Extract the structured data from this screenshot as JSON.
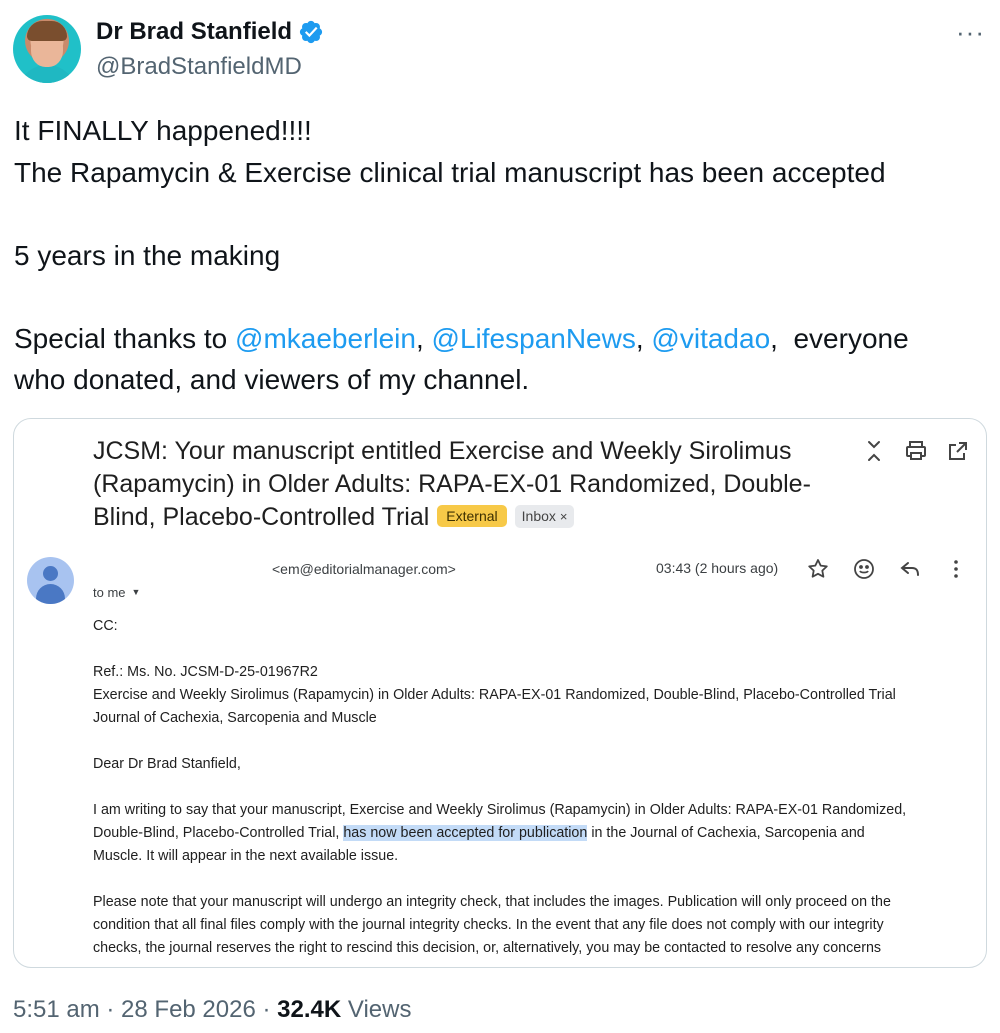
{
  "author": {
    "display_name": "Dr Brad Stanfield",
    "handle": "@BradStanfieldMD",
    "verified": true,
    "verified_color": "#1d9bf0"
  },
  "more_label": "···",
  "tweet": {
    "line1": "It FINALLY happened!!!!",
    "line2": "The Rapamycin & Exercise clinical trial manuscript has been accepted",
    "line3": "5 years in the making",
    "line4_prefix": "Special thanks to ",
    "mention1": "@mkaeberlein",
    "sep1": ", ",
    "mention2": "@LifespanNews",
    "sep2": ", ",
    "mention3": "@vitadao",
    "line4_suffix": ",  everyone",
    "line5": "who donated, and viewers of my channel.",
    "mention_color": "#1d9bf0"
  },
  "email": {
    "subject": "JCSM: Your manuscript entitled Exercise and Weekly Sirolimus (Rapamycin) in Older Adults: RAPA-EX-01 Randomized, Double-Blind, Placebo-Controlled Trial",
    "tag_external": "External",
    "tag_inbox": "Inbox",
    "tag_close": "×",
    "sender": "<em@editorialmanager.com>",
    "time": "03:43 (2 hours ago)",
    "to": "to me",
    "caret": "▼",
    "cc": "CC:",
    "ref": "Ref.:  Ms. No. JCSM-D-25-01967R2",
    "ref_title": "Exercise and Weekly Sirolimus (Rapamycin) in Older Adults: RAPA-EX-01 Randomized, Double-Blind, Placebo-Controlled Trial",
    "journal": "Journal of Cachexia, Sarcopenia and Muscle",
    "greeting": "Dear Dr Brad Stanfield,",
    "p1_a": "I am writing to say that your manuscript, Exercise and Weekly Sirolimus (Rapamycin) in Older Adults: RAPA-EX-01 Randomized,",
    "p1_b": "Double-Blind, Placebo-Controlled Trial, ",
    "p1_highlight": "has now been accepted for publication",
    "p1_c": " in the Journal of Cachexia, Sarcopenia and",
    "p1_d": "Muscle. It will appear in the next available issue.",
    "p2_a": "Please note that your manuscript will undergo an integrity check, that includes the images. Publication will only proceed on the",
    "p2_b": "condition that all final files comply with the journal integrity checks. In the event that any file does not comply with our integrity",
    "p2_c": "checks, the journal reserves the right to rescind this decision, or, alternatively, you may be contacted to resolve any concerns",
    "highlight_color": "#c3dbf7",
    "tag_external_color": "#f7c948"
  },
  "footer": {
    "time": "5:51 am",
    "dot1": " · ",
    "date": "28 Feb 2026",
    "dot2": " · ",
    "views_count": "32.4K",
    "views_label": " Views"
  }
}
